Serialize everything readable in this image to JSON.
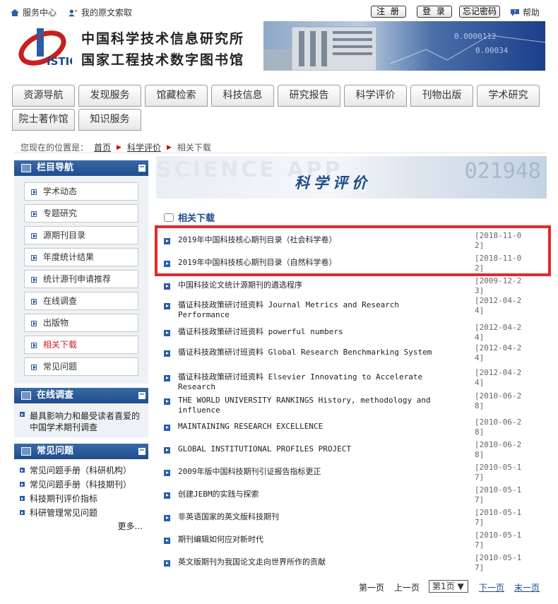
{
  "topbar": {
    "service_center": "服务中心",
    "my_requests": "我的原文索取",
    "register": "注 册",
    "login": "登 录",
    "forgot_password": "忘记密码",
    "help": "帮助"
  },
  "header": {
    "org_name_1": "中国科学技术信息研究所",
    "org_name_2": "国家工程技术数字图书馆",
    "logo_text": "ISTIC"
  },
  "nav": {
    "tabs": [
      "资源导航",
      "发现服务",
      "馆藏检索",
      "科技信息",
      "研究报告",
      "科学评价",
      "刊物出版",
      "学术研究",
      "院士著作馆",
      "知识服务"
    ]
  },
  "breadcrumb": {
    "prefix": "您现在的位置是：",
    "home": "首页",
    "section": "科学评价",
    "current": "相关下载"
  },
  "sidebar": {
    "nav_title": "栏目导航",
    "nav_items": [
      "学术动态",
      "专题研究",
      "源期刊目录",
      "年度统计结果",
      "统计源刊申请推荐",
      "在线调查",
      "出版物",
      "相关下载",
      "常见问题"
    ],
    "survey_title": "在线调查",
    "survey_items": [
      "最具影响力和最受读者喜爱的中国学术期刊调查"
    ],
    "faq_title": "常见问题",
    "faq_items": [
      "常见问题手册（科研机构）",
      "常见问题手册（科技期刊）",
      "科技期刊评价指标",
      "科研管理常见问题"
    ],
    "more": "更多..."
  },
  "main": {
    "banner_bg_text": "SCIENCE APP",
    "banner_title": "科学评价",
    "banner_nums": "021948",
    "section_title": "相关下载",
    "articles": [
      {
        "title": "2019年中国科技核心期刊目录（社会科学卷）",
        "date": "[2018-11-02]"
      },
      {
        "title": "2019年中国科技核心期刊目录（自然科学卷）",
        "date": "[2018-11-02]"
      },
      {
        "title": "中国科技论文统计源期刊的遴选程序",
        "date": "[2009-12-23]"
      },
      {
        "title": "循证科技政策研讨班资料 Journal Metrics and Research Performance",
        "date": "[2012-04-24]"
      },
      {
        "title": "循证科技政策研讨班资料 powerful numbers",
        "date": "[2012-04-24]"
      },
      {
        "title": "循证科技政策研讨班资料 Global Research Benchmarking System",
        "date": "[2012-04-24]"
      },
      {
        "title": "循证科技政策研讨班资料 Elsevier Innovating to Accelerate Research",
        "date": "[2012-04-24]"
      },
      {
        "title": "THE WORLD UNIVERSITY RANKINGS History, methodology and influence",
        "date": "[2010-06-28]"
      },
      {
        "title": "MAINTAINING RESEARCH EXCELLENCE",
        "date": "[2010-06-28]"
      },
      {
        "title": "GLOBAL INSTITUTIONAL PROFILES PROJECT",
        "date": "[2010-06-28]"
      },
      {
        "title": "2009年版中国科技期刊引证报告指标更正",
        "date": "[2010-05-17]"
      },
      {
        "title": "创建JEBM的实践与探索",
        "date": "[2010-05-17]"
      },
      {
        "title": "非英语国家的英文版科技期刊",
        "date": "[2010-05-17]"
      },
      {
        "title": "期刊编辑如何应对新时代",
        "date": "[2010-05-17]"
      },
      {
        "title": "英文版期刊为我国论文走向世界所作的贡献",
        "date": "[2010-05-17]"
      }
    ]
  },
  "pager": {
    "first": "第一页",
    "prev": "上一页",
    "current": "第1页 ▼",
    "next": "下一页",
    "last": "末一页"
  },
  "colors": {
    "primary": "#1f4c8c",
    "highlight": "#e8262a",
    "active_nav": "#d02020"
  }
}
